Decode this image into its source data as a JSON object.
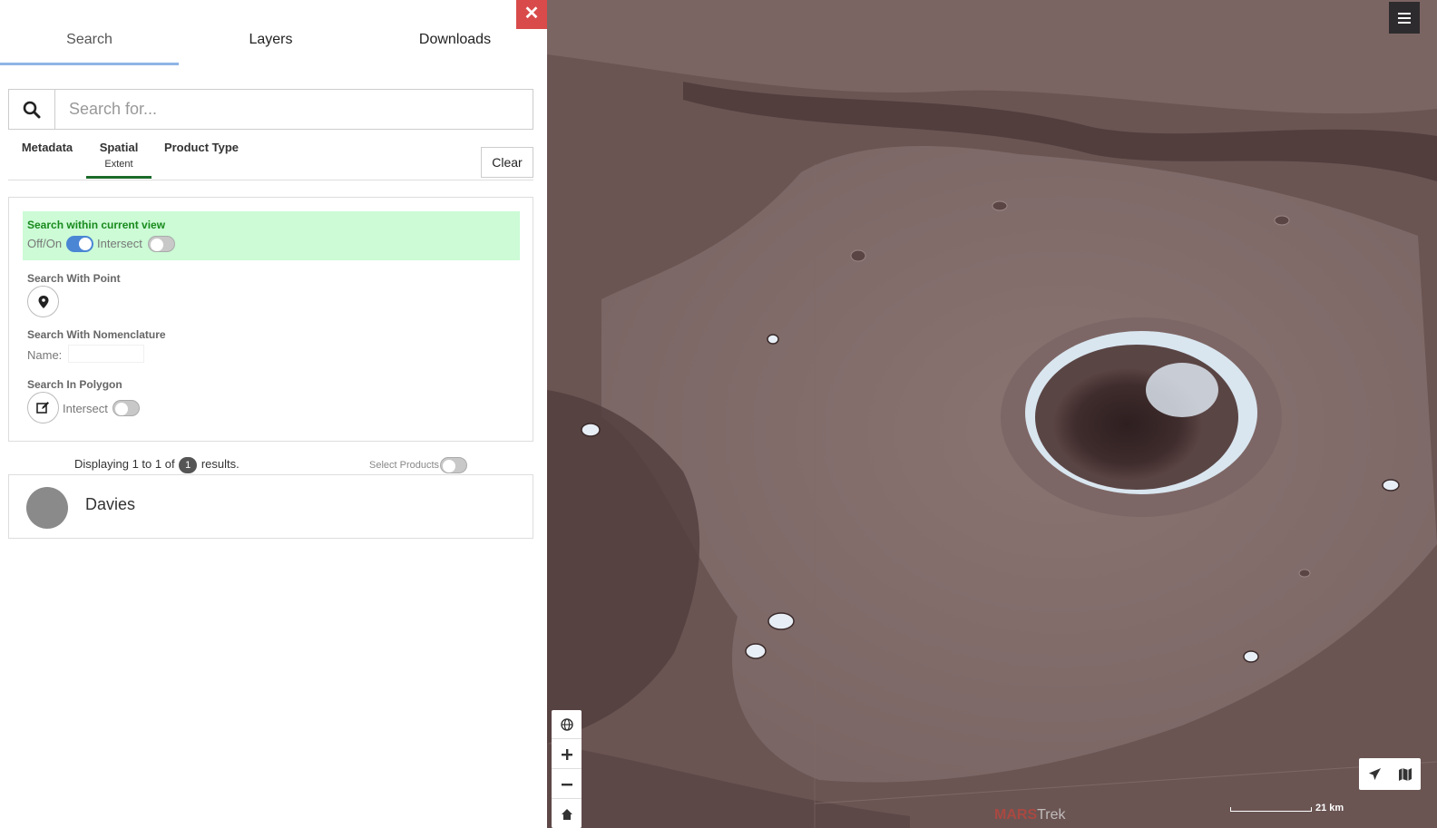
{
  "tabs": [
    {
      "label": "Search"
    },
    {
      "label": "Layers"
    },
    {
      "label": "Downloads"
    }
  ],
  "close_symbol": "✕",
  "search": {
    "placeholder": "Search for...",
    "value": ""
  },
  "subtabs": [
    {
      "label": "Metadata",
      "sub": ""
    },
    {
      "label": "Spatial",
      "sub": "Extent"
    },
    {
      "label": "Product Type",
      "sub": ""
    }
  ],
  "clear_label": "Clear",
  "spatial": {
    "current_view_title": "Search within current view",
    "offon_label": "Off/On",
    "intersect_label": "Intersect",
    "point_title": "Search With Point",
    "nomenclature_title": "Search With Nomenclature",
    "name_label": "Name:",
    "name_value": "",
    "polygon_title": "Search In Polygon",
    "polygon_intersect_label": "Intersect",
    "current_view_on": true,
    "current_view_intersect_on": false,
    "polygon_intersect_on": false
  },
  "results": {
    "prefix": "Displaying 1 to 1 of",
    "count": "1",
    "suffix": "results.",
    "select_products_label": "Select Products",
    "select_products_on": false,
    "items": [
      {
        "name": "Davies"
      }
    ]
  },
  "map": {
    "scale_label": "21 km",
    "logo_main": "MARS",
    "logo_trek": "Trek",
    "icons": {
      "menu": "hamburger-icon",
      "globe": "globe-icon",
      "zoom_in": "plus-icon",
      "zoom_out": "minus-icon",
      "home": "home-icon",
      "fly": "airplane-icon",
      "map": "map-icon"
    }
  },
  "colors": {
    "accent_blue": "#4a86d4",
    "close_red": "#d94b4b",
    "green_highlight": "#ccfbd6",
    "green_text": "#188a1c",
    "subtab_underline": "#1b6b2a"
  }
}
